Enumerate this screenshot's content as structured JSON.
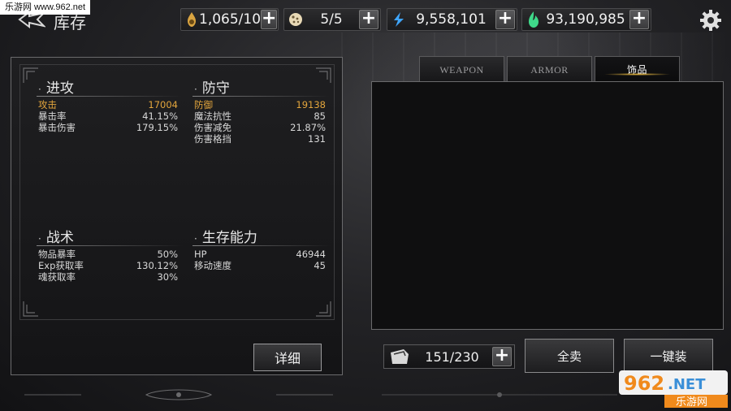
{
  "watermark_top": "乐游网 www.962.net",
  "header": {
    "title": "库存"
  },
  "resources": [
    {
      "icon": "oil-lamp-icon",
      "value": "1,065/10"
    },
    {
      "icon": "cookie-icon",
      "value": "5/5"
    },
    {
      "icon": "blue-crystal-icon",
      "value": "9,558,101"
    },
    {
      "icon": "green-soul-icon",
      "value": "93,190,985"
    }
  ],
  "stats": {
    "attack": {
      "title": "进攻",
      "rows": [
        {
          "label": "攻击",
          "value": "17004",
          "highlight": true
        },
        {
          "label": "暴击率",
          "value": "41.15%"
        },
        {
          "label": "暴击伤害",
          "value": "179.15%"
        }
      ]
    },
    "defense": {
      "title": "防守",
      "rows": [
        {
          "label": "防御",
          "value": "19138",
          "highlight": true
        },
        {
          "label": "魔法抗性",
          "value": "85"
        },
        {
          "label": "伤害减免",
          "value": "21.87%"
        },
        {
          "label": "伤害格挡",
          "value": "131"
        }
      ]
    },
    "tactics": {
      "title": "战术",
      "rows": [
        {
          "label": "物品暴率",
          "value": "50%"
        },
        {
          "label": "Exp获取率",
          "value": "130.12%"
        },
        {
          "label": "魂获取率",
          "value": "30%"
        }
      ]
    },
    "survival": {
      "title": "生存能力",
      "rows": [
        {
          "label": "HP",
          "value": "46944"
        },
        {
          "label": "移动速度",
          "value": "45"
        }
      ]
    },
    "detail_button": "详细"
  },
  "tabs": [
    {
      "label": "WEAPON",
      "active": false
    },
    {
      "label": "ARMOR",
      "active": false
    },
    {
      "label": "饰品",
      "active": true
    }
  ],
  "inventory": {
    "capacity": "151/230",
    "sell_all_button": "全卖",
    "equip_all_button": "一键装"
  },
  "colors": {
    "highlight": "#e3a53c",
    "crystal": "#3fa6ff",
    "soul": "#3fd98a"
  }
}
